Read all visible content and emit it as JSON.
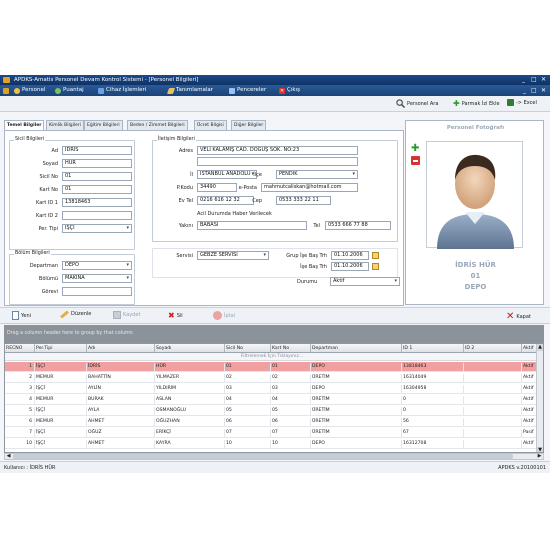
{
  "window": {
    "title": "APDKS-Amatis Personel Devam Kontrol Sistemi - [Personel Bilgileri]",
    "controls": [
      "_",
      "□",
      "✕"
    ]
  },
  "menu": [
    {
      "label": "Personel",
      "icon": "person-icon",
      "color": "#f0c040"
    },
    {
      "label": "Puantaj",
      "icon": "puantaj-icon",
      "color": "#7fc060"
    },
    {
      "label": "Cihaz İşlemleri",
      "icon": "device-icon",
      "color": "#6da0e0"
    },
    {
      "label": "Tanımlamalar",
      "icon": "pencil-icon",
      "color": "#e8c060"
    },
    {
      "label": "Pencereler",
      "icon": "windows-icon",
      "color": "#9ec0f0"
    },
    {
      "label": "Çıkış",
      "icon": "exit-icon",
      "color": "#e03030"
    }
  ],
  "toolbar2": {
    "search": "Personel Ara",
    "fingerprint": "Parmak İzi Ekle",
    "excel": "-> Excel"
  },
  "tabs": [
    "Temel Bilgiler",
    "Kimlik Bilgileri",
    "Eğitim Bilgileri",
    "Beden / Zimmet Bilgileri",
    "Ücret Bilgisi",
    "Diğer Bilgiler"
  ],
  "sicil": {
    "title": "Sicil Bilgileri",
    "ad_label": "Ad",
    "ad": "İDRİS",
    "soyad_label": "Soyad",
    "soyad": "HÜR",
    "sicilno_label": "Sicil No",
    "sicilno": "01",
    "kartno_label": "Kart No",
    "kartno": "01",
    "kartid1_label": "Kart ID 1",
    "kartid1": "13818463",
    "kartid2_label": "Kart ID 2",
    "kartid2": "",
    "pertipi_label": "Per. Tipi",
    "pertipi": "İŞÇİ"
  },
  "bolum": {
    "title": "Bölüm Bilgileri",
    "departman_label": "Departman",
    "departman": "DEPO",
    "bolumu_label": "Bölümü",
    "bolumu": "MAKİNA",
    "gorevi_label": "Görevi",
    "gorevi": ""
  },
  "iletisim": {
    "title": "İletişim Bilgileri",
    "adres_label": "Adres",
    "adres": "VELİ KALAMIŞ CAD. DOĞUŞ SOK. NO:23",
    "il_label": "İl",
    "il": "İSTANBUL ANADOLU",
    "ilce_label": "İlçe",
    "ilce": "PENDİK",
    "pkodu_label": "P.Kodu",
    "pkodu": "34490",
    "eposta_label": "e-Posta",
    "eposta": "mahmutcaliskan@hotmail.com",
    "evtel_label": "Ev Tel",
    "evtel": "0216 616 12 32",
    "cep_label": "Cep",
    "cep": "0533 333 22 11",
    "acil_title": "Acil Durumda Haber Verilecek",
    "yakini_label": "Yakını",
    "yakini": "BABASI",
    "tel_label": "Tel",
    "tel": "0533 666 77 88"
  },
  "servis": {
    "servisi_label": "Servisi",
    "servisi": "GEBZE SERVİSİ",
    "grup_label": "Grup İşe Baş Trh",
    "grup": "01.10.2006",
    "ise_label": "İşe Baş Trh",
    "ise": "01.10.2006",
    "durum_label": "Durumu",
    "durum": "Aktif"
  },
  "photo": {
    "title": "Personel Fotoğrafı",
    "name": "İDRİS HÜR",
    "no": "01",
    "dept": "DEPO"
  },
  "actions": {
    "yeni": "Yeni",
    "duzenle": "Düzenle",
    "kaydet": "Kaydet",
    "sil": "Sil",
    "iptal": "İptal",
    "kapat": "Kapat"
  },
  "grid": {
    "group_hint": "Drag a column header here to group by that column",
    "filter_hint": "Filtrelemek İçin Tıklayınız...",
    "columns": [
      "RECNO",
      "Per.Tipi",
      "Adı",
      "Soyadı",
      "Sicil No",
      "Kart No",
      "Departman",
      "ID 1",
      "ID 2",
      "Aktif"
    ],
    "rows": [
      [
        "1",
        "İŞÇİ",
        "İDRİS",
        "HÜR",
        "01",
        "01",
        "DEPO",
        "13818463",
        "",
        "Aktif"
      ],
      [
        "2",
        "MEMUR",
        "BAHATTİN",
        "YILMAZER",
        "02",
        "02",
        "ÜRETİM",
        "16314049",
        "",
        "Aktif"
      ],
      [
        "3",
        "İŞÇİ",
        "AYLİN",
        "YILDIRIM",
        "03",
        "03",
        "DEPO",
        "16304958",
        "",
        "Aktif"
      ],
      [
        "4",
        "MEMUR",
        "BURAK",
        "ASLAN",
        "04",
        "04",
        "ÜRETİM",
        "0",
        "",
        "Aktif"
      ],
      [
        "5",
        "İŞÇİ",
        "AYLA",
        "OSMANOĞLU",
        "05",
        "05",
        "ÜRETİM",
        "0",
        "",
        "Aktif"
      ],
      [
        "6",
        "MEMUR",
        "AHMET",
        "OĞUZHAN",
        "06",
        "06",
        "ÜRETİM",
        "56",
        "",
        "Aktif"
      ],
      [
        "7",
        "İŞÇİ",
        "OĞUZ",
        "ERİKÇİ",
        "07",
        "07",
        "ÜRETİM",
        "67",
        "",
        "Pasif"
      ],
      [
        "10",
        "İŞÇİ",
        "AHMET",
        "KAYRA",
        "10",
        "10",
        "DEPO",
        "16312708",
        "",
        "Aktif"
      ]
    ]
  },
  "status": {
    "user": "Kullanıcı : İDRİS HÜR",
    "version": "APDKS v.20100101"
  },
  "colors": {
    "title": "#0e3267",
    "selected_row": "#f0a0a0",
    "photo_text": "#9aa8ba"
  }
}
